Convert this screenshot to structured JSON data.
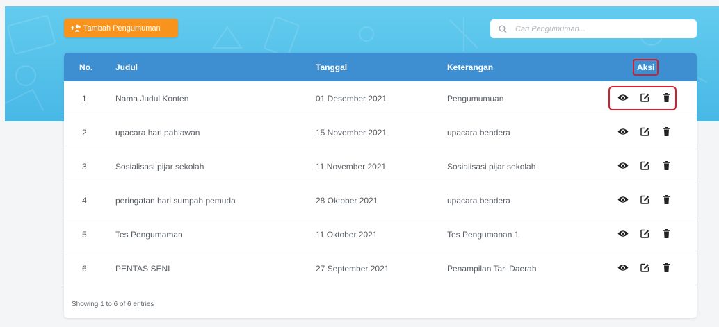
{
  "toolbar": {
    "add_label": "Tambah Pengumuman",
    "search_placeholder": "Cari Pengumuman..."
  },
  "table": {
    "headers": {
      "no": "No.",
      "judul": "Judul",
      "tanggal": "Tanggal",
      "keterangan": "Keterangan",
      "aksi": "Aksi"
    },
    "rows": [
      {
        "no": "1",
        "judul": "Nama Judul Konten",
        "tanggal": "01 Desember 2021",
        "keterangan": "Pengumumuan"
      },
      {
        "no": "2",
        "judul": "upacara hari pahlawan",
        "tanggal": "15 November 2021",
        "keterangan": "upacara bendera"
      },
      {
        "no": "3",
        "judul": "Sosialisasi pijar sekolah",
        "tanggal": "11 November 2021",
        "keterangan": "Sosialisasi pijar sekolah"
      },
      {
        "no": "4",
        "judul": "peringatan hari sumpah pemuda",
        "tanggal": "28 Oktober 2021",
        "keterangan": "upacara bendera"
      },
      {
        "no": "5",
        "judul": "Tes Pengumaman",
        "tanggal": "11 Oktober 2021",
        "keterangan": "Tes Pengumanan 1"
      },
      {
        "no": "6",
        "judul": "PENTAS SENI",
        "tanggal": "27 September 2021",
        "keterangan": "Penampilan Tari Daerah"
      }
    ],
    "row_icons": [
      "eye-icon",
      "edit-icon",
      "trash-icon"
    ],
    "footer": "Showing 1 to 6 of 6 entries"
  },
  "colors": {
    "header_bg": "#48b8e6",
    "table_head": "#3d8fd1",
    "add_button": "#f8941e",
    "highlight": "#d61f2a"
  }
}
